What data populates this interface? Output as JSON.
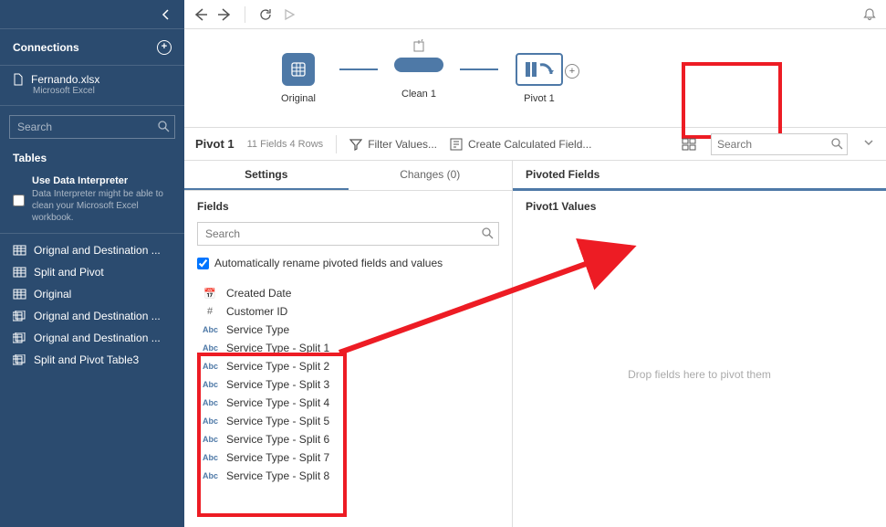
{
  "sidebar": {
    "connections_label": "Connections",
    "connection": {
      "name": "Fernando.xlsx",
      "type": "Microsoft Excel"
    },
    "search_placeholder": "Search",
    "tables_label": "Tables",
    "interpreter_title": "Use Data Interpreter",
    "interpreter_desc": "Data Interpreter might be able to clean your Microsoft Excel workbook.",
    "tables": [
      {
        "label": "Orignal and Destination ...",
        "kind": "single"
      },
      {
        "label": "Split and Pivot",
        "kind": "single"
      },
      {
        "label": "Original",
        "kind": "single"
      },
      {
        "label": "Orignal and Destination ...",
        "kind": "multi"
      },
      {
        "label": "Orignal and Destination ...",
        "kind": "multi"
      },
      {
        "label": "Split and Pivot Table3",
        "kind": "multi"
      }
    ]
  },
  "flow": {
    "steps": [
      {
        "label": "Original",
        "id": "original"
      },
      {
        "label": "Clean 1",
        "id": "clean1"
      },
      {
        "label": "Pivot 1",
        "id": "pivot1"
      }
    ]
  },
  "step_bar": {
    "title": "Pivot 1",
    "meta": "11 Fields  4 Rows",
    "filter_label": "Filter Values...",
    "calc_label": "Create Calculated Field...",
    "search_placeholder": "Search"
  },
  "tabs": {
    "settings": "Settings",
    "changes": "Changes (0)"
  },
  "fields_panel": {
    "header": "Fields",
    "search_placeholder": "Search",
    "auto_rename": "Automatically rename pivoted fields and values",
    "fields": [
      {
        "icon": "date",
        "label": "Created Date"
      },
      {
        "icon": "num",
        "label": "Customer ID"
      },
      {
        "icon": "abc",
        "label": "Service Type"
      },
      {
        "icon": "abc",
        "label": "Service Type - Split 1"
      },
      {
        "icon": "abc",
        "label": "Service Type - Split 2"
      },
      {
        "icon": "abc",
        "label": "Service Type - Split 3"
      },
      {
        "icon": "abc",
        "label": "Service Type - Split 4"
      },
      {
        "icon": "abc",
        "label": "Service Type - Split 5"
      },
      {
        "icon": "abc",
        "label": "Service Type - Split 6"
      },
      {
        "icon": "abc",
        "label": "Service Type - Split 7"
      },
      {
        "icon": "abc",
        "label": "Service Type - Split 8"
      }
    ]
  },
  "right_panel": {
    "pivoted_label": "Pivoted Fields",
    "values_label": "Pivot1 Values",
    "drop_hint": "Drop fields here to pivot them"
  }
}
